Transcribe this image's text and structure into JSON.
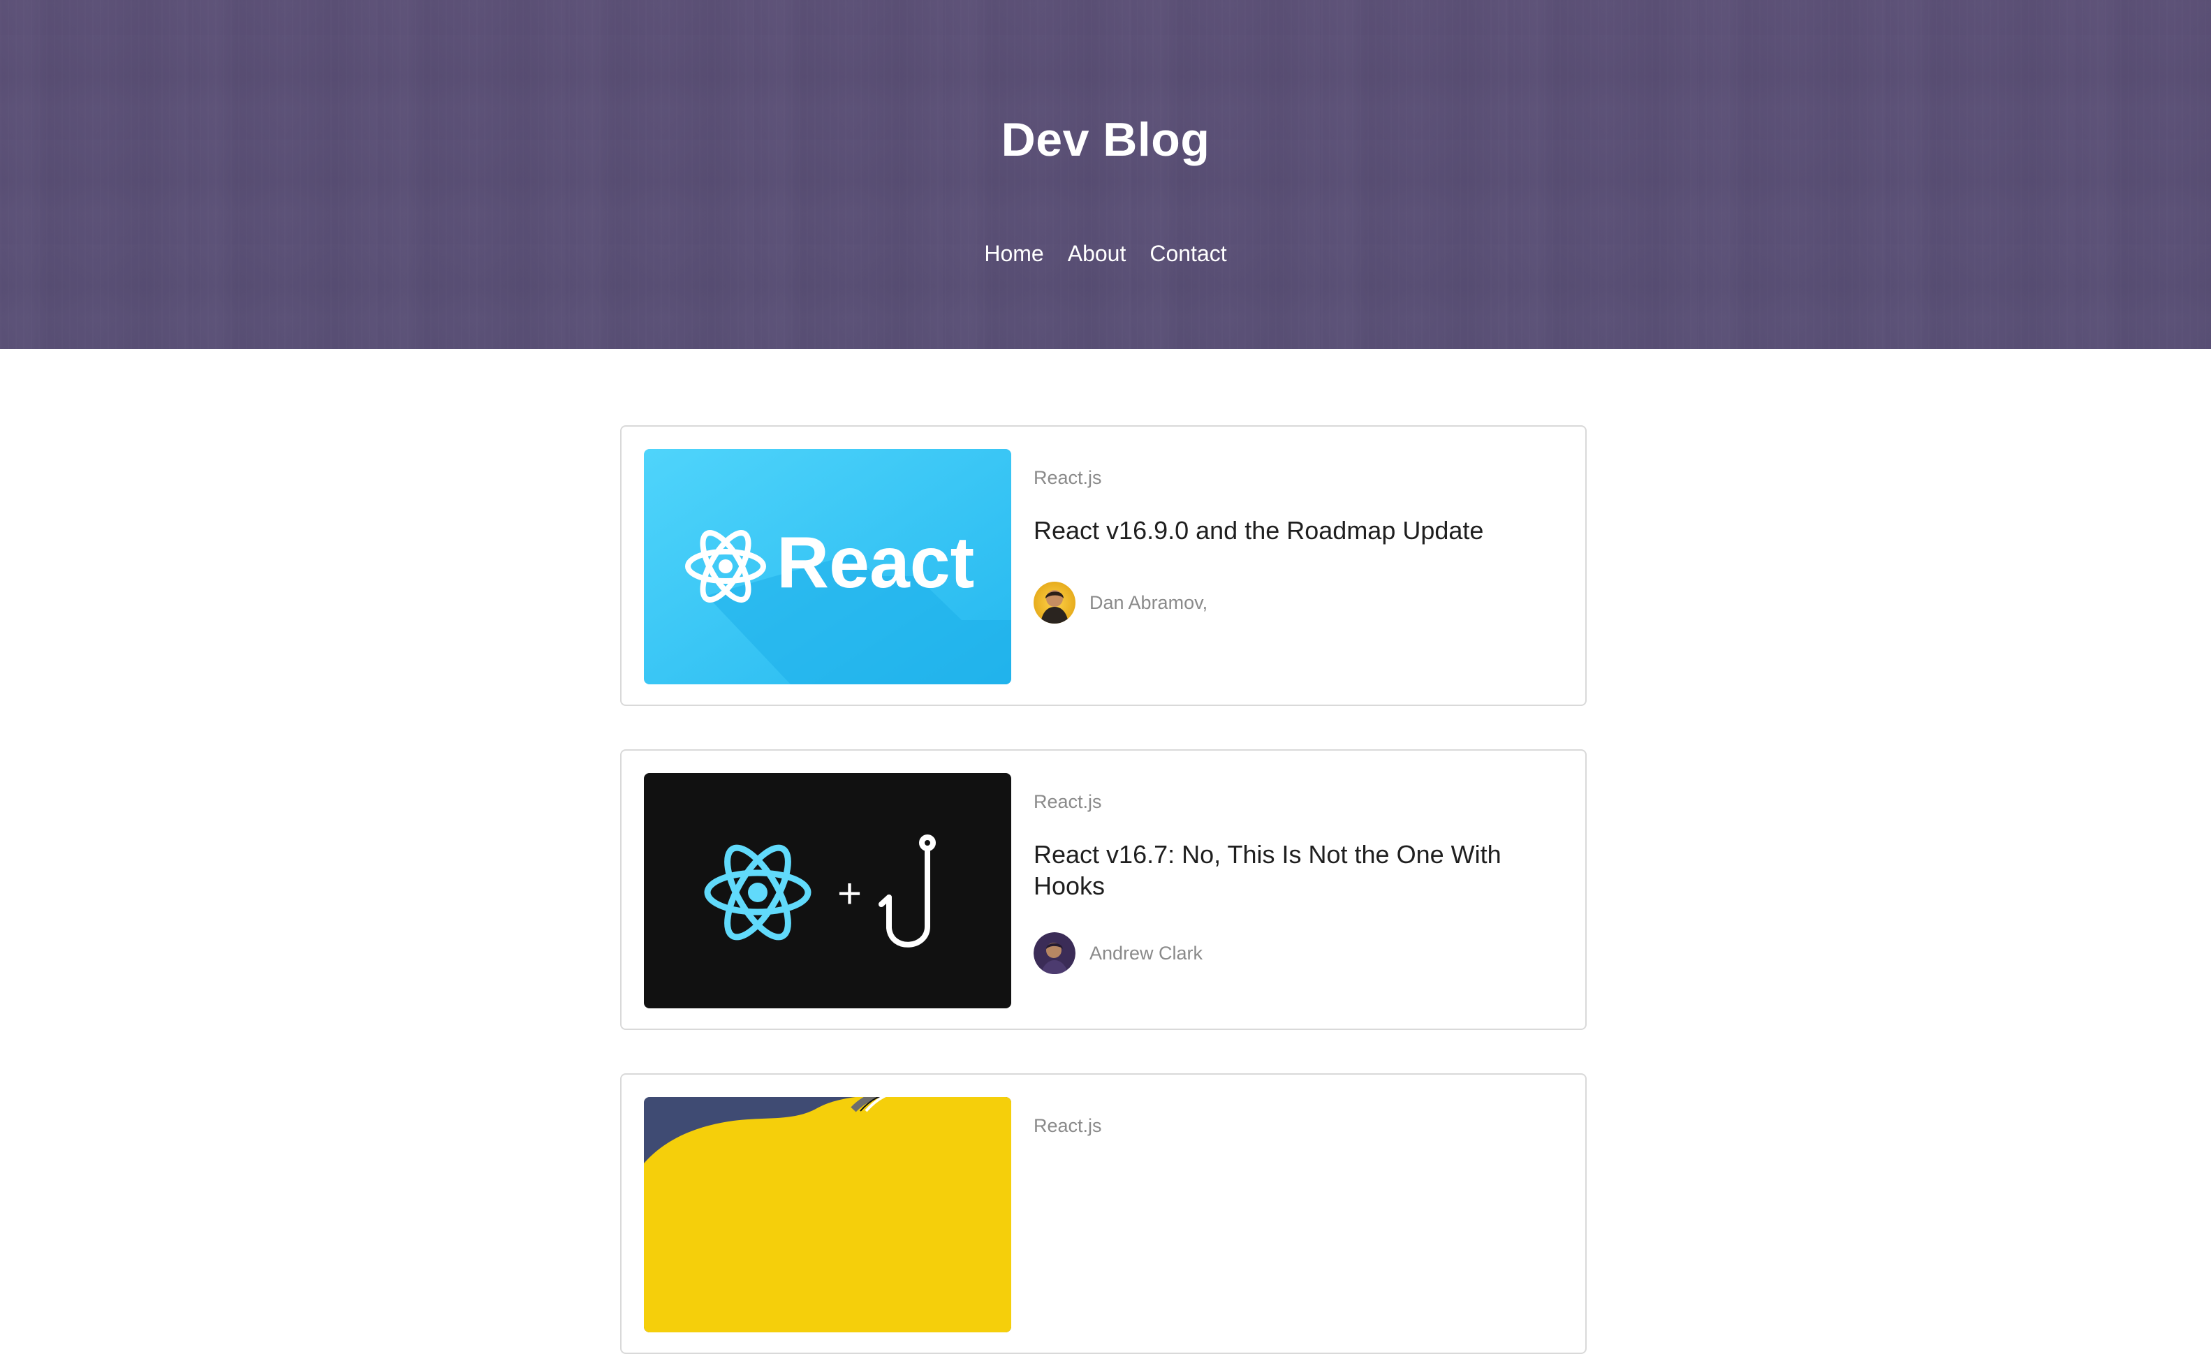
{
  "site": {
    "title": "Dev Blog",
    "nav": [
      "Home",
      "About",
      "Contact"
    ]
  },
  "posts": [
    {
      "category": "React.js",
      "title": "React v16.9.0 and the Roadmap Update",
      "author": "Dan Abramov,",
      "thumb_text": "React"
    },
    {
      "category": "React.js",
      "title": "React v16.7: No, This Is Not the One With Hooks",
      "author": "Andrew Clark",
      "thumb_symbol": "+"
    },
    {
      "category": "React.js"
    }
  ],
  "colors": {
    "hero_overlay": "#5a4e76",
    "react_blue": "#39c6f4",
    "react_logo_light": "#61dafb",
    "dark_thumb": "#111111",
    "yellow_thumb": "#f5cf0b",
    "navy_thumb": "#3f4b73",
    "text_muted": "#8a8a8a",
    "text_title": "#1f1f1f",
    "card_border": "#d9d9d9"
  },
  "icons": {
    "react_logo": "react-atom-icon",
    "hook": "hook-icon"
  }
}
